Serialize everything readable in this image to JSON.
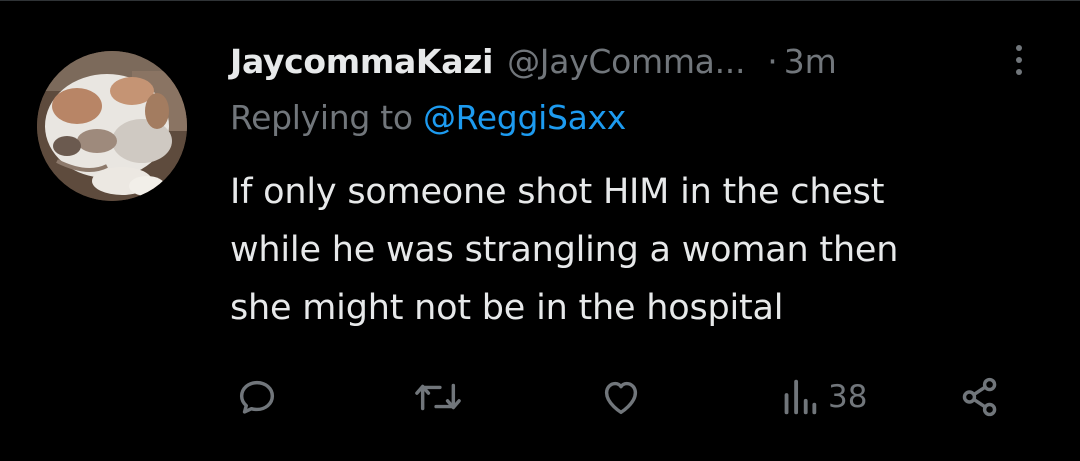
{
  "author": {
    "display_name": "JaycommaKazi",
    "handle": "@JayComma...",
    "separator": "·",
    "time": "3m"
  },
  "reply": {
    "prefix": "Replying to",
    "mention": "@ReggiSaxx"
  },
  "tweet": {
    "line1": "If only someone shot HIM in the chest",
    "line2": "while he was strangling a woman then",
    "line3": "she might not be in the hospital"
  },
  "actions": {
    "views": "38",
    "icons": [
      "reply-icon",
      "retweet-icon",
      "like-icon",
      "views-icon",
      "share-icon"
    ]
  },
  "colors": {
    "background": "#000000",
    "text": "#e7e9ea",
    "muted": "#71767b",
    "link": "#1d9bf0"
  }
}
